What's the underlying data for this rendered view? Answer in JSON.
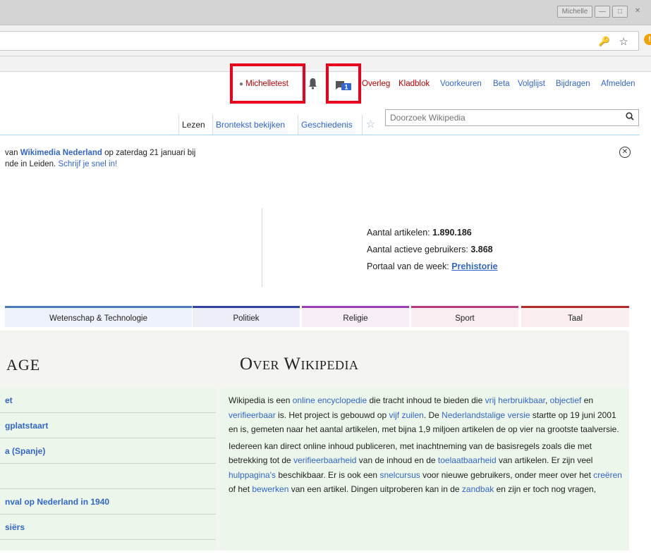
{
  "window": {
    "profile_label": "Michelle",
    "minimize_glyph": "—",
    "maximize_glyph": "□",
    "close_glyph": "✕"
  },
  "toolbar": {
    "key_icon_glyph": "🔑",
    "star_icon_glyph": "☆",
    "extension_glyph": "!"
  },
  "personal": {
    "username": "Michelletest",
    "links": [
      "Overleg",
      "Kladblok",
      "Voorkeuren",
      "Beta",
      "Volglijst",
      "Bijdragen",
      "Afmelden"
    ],
    "notification_count": "1"
  },
  "tabs": [
    "Lezen",
    "Brontekst bekijken",
    "Geschiedenis"
  ],
  "search": {
    "placeholder": "Doorzoek Wikipedia"
  },
  "notice": {
    "line1_pre": "van ",
    "line1_link": "Wikimedia Nederland",
    "line1_post": " op zaterdag 21 januari bij",
    "line2_pre": "nde in Leiden. ",
    "line2_link": "Schrijf je snel in!"
  },
  "stats": {
    "articles_label": "Aantal artikelen: ",
    "articles_value": "1.890.186",
    "users_label": "Aantal actieve gebruikers: ",
    "users_value": "3.868",
    "portal_label": "Portaal van de week: ",
    "portal_value": "Prehistorie"
  },
  "portals": [
    {
      "label": "Wetenschap & Technologie",
      "color": "#4a7ab8",
      "bg": "#eef2fa"
    },
    {
      "label": "Politiek",
      "color": "#3340a0",
      "bg": "#eceef8"
    },
    {
      "label": "Religie",
      "color": "#9a3fb0",
      "bg": "#f8eef8"
    },
    {
      "label": "Sport",
      "color": "#b83a7a",
      "bg": "#fbeef3"
    },
    {
      "label": "Taal",
      "color": "#b02a2a",
      "bg": "#fbeeee"
    }
  ],
  "left_section": {
    "heading": "AGE",
    "items": [
      "et",
      "gplatstaart",
      "a (Spanje)",
      "",
      "nval op Nederland in 1940",
      "siërs"
    ]
  },
  "right_section": {
    "heading": "Over Wikipedia",
    "p1": {
      "t1": "Wikipedia is een ",
      "l1": "online encyclopedie",
      "t2": " die tracht inhoud te bieden die ",
      "l2": "vrij herbruikbaar",
      "t3": ", ",
      "l3": "objectief",
      "t4": " en ",
      "l4": "verifieerbaar",
      "t5": " is. Het project is gebouwd op ",
      "l5": "vijf zuilen",
      "t6": ". De ",
      "l6": "Nederlandstalige versie",
      "t7": " startte op 19 juni 2001 en is, gemeten naar het aantal artikelen, met bijna 1,9 miljoen artikelen de op vier na grootste taalversie."
    },
    "p2": {
      "t1": "Iedereen kan direct online inhoud publiceren, met inachtneming van de basisregels zoals die met betrekking tot de ",
      "l1": "verifieerbaarheid",
      "t2": " van de inhoud en de ",
      "l2": "toelaatbaarheid",
      "t3": " van artikelen. Er zijn veel ",
      "l3": "hulppagina's",
      "t4": " beschikbaar. Er is ook een ",
      "l4": "snelcursus",
      "t5": " voor nieuwe gebruikers, onder meer over het ",
      "l5": "creëren",
      "t6": " of het ",
      "l6": "bewerken",
      "t7": " van een artikel. Dingen uitproberen kan in de ",
      "l7": "zandbak",
      "t8": " en zijn er toch nog vragen,"
    }
  },
  "colors": {
    "highlight_red": "#e8001c",
    "link_blue": "#3366cc",
    "redlink": "#ba0000",
    "section_green": "#ecf6ea"
  }
}
